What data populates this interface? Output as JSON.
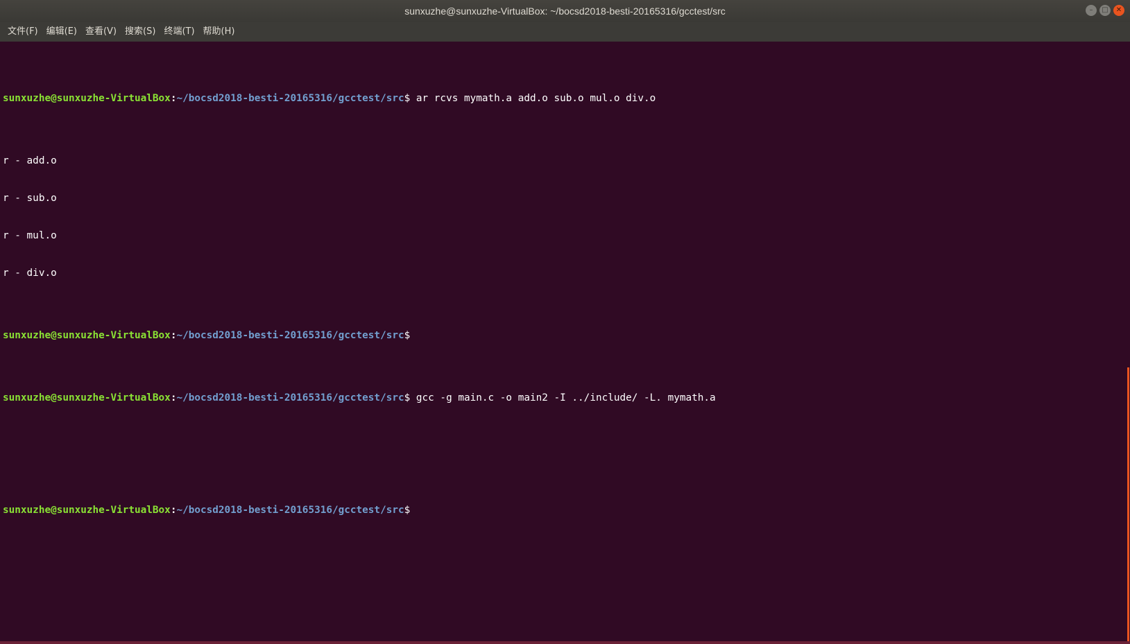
{
  "window": {
    "title": "sunxuzhe@sunxuzhe-VirtualBox: ~/bocsd2018-besti-20165316/gcctest/src",
    "controls": [
      {
        "icon": "minimize-icon",
        "glyph": "–"
      },
      {
        "icon": "maximize-icon",
        "glyph": "□"
      },
      {
        "icon": "close-icon",
        "glyph": "✕"
      }
    ]
  },
  "menu": {
    "file": "文件(F)",
    "edit": "编辑(E)",
    "view": "查看(V)",
    "search": "搜索(S)",
    "terminal": "终端(T)",
    "help": "帮助(H)"
  },
  "terminal": {
    "user_host": "sunxuzhe@sunxuzhe-VirtualBox",
    "path": "~/bocsd2018-besti-20165316/gcctest/src",
    "cmd1": " ar rcvs mymath.a add.o sub.o mul.o div.o",
    "cmd2": " gcc -g main.c -o main2 -I ../include/ -L. mymath.a",
    "ar_out": [
      "r - add.o",
      "r - sub.o",
      "r - mul.o",
      "r - div.o"
    ],
    "colors": {
      "background": "#300a24",
      "prompt_user": "#8ae234",
      "prompt_path": "#729fcf",
      "warning": "#ad7fa8",
      "note": "#34e2e2",
      "fixit": "#4e9a06",
      "scroll_thumb": "#e95420"
    }
  }
}
